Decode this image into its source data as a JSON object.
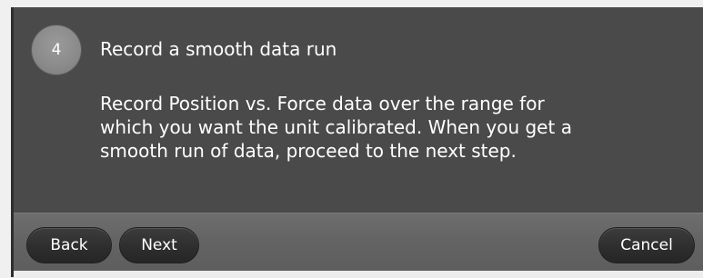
{
  "step": {
    "number": "4",
    "title": "Record a smooth data run",
    "body": "Record Position vs. Force data over the range for\nwhich you want the unit calibrated. When you get a\nsmooth run of data, proceed to the next step."
  },
  "footer": {
    "back_label": "Back",
    "next_label": "Next",
    "cancel_label": "Cancel"
  }
}
